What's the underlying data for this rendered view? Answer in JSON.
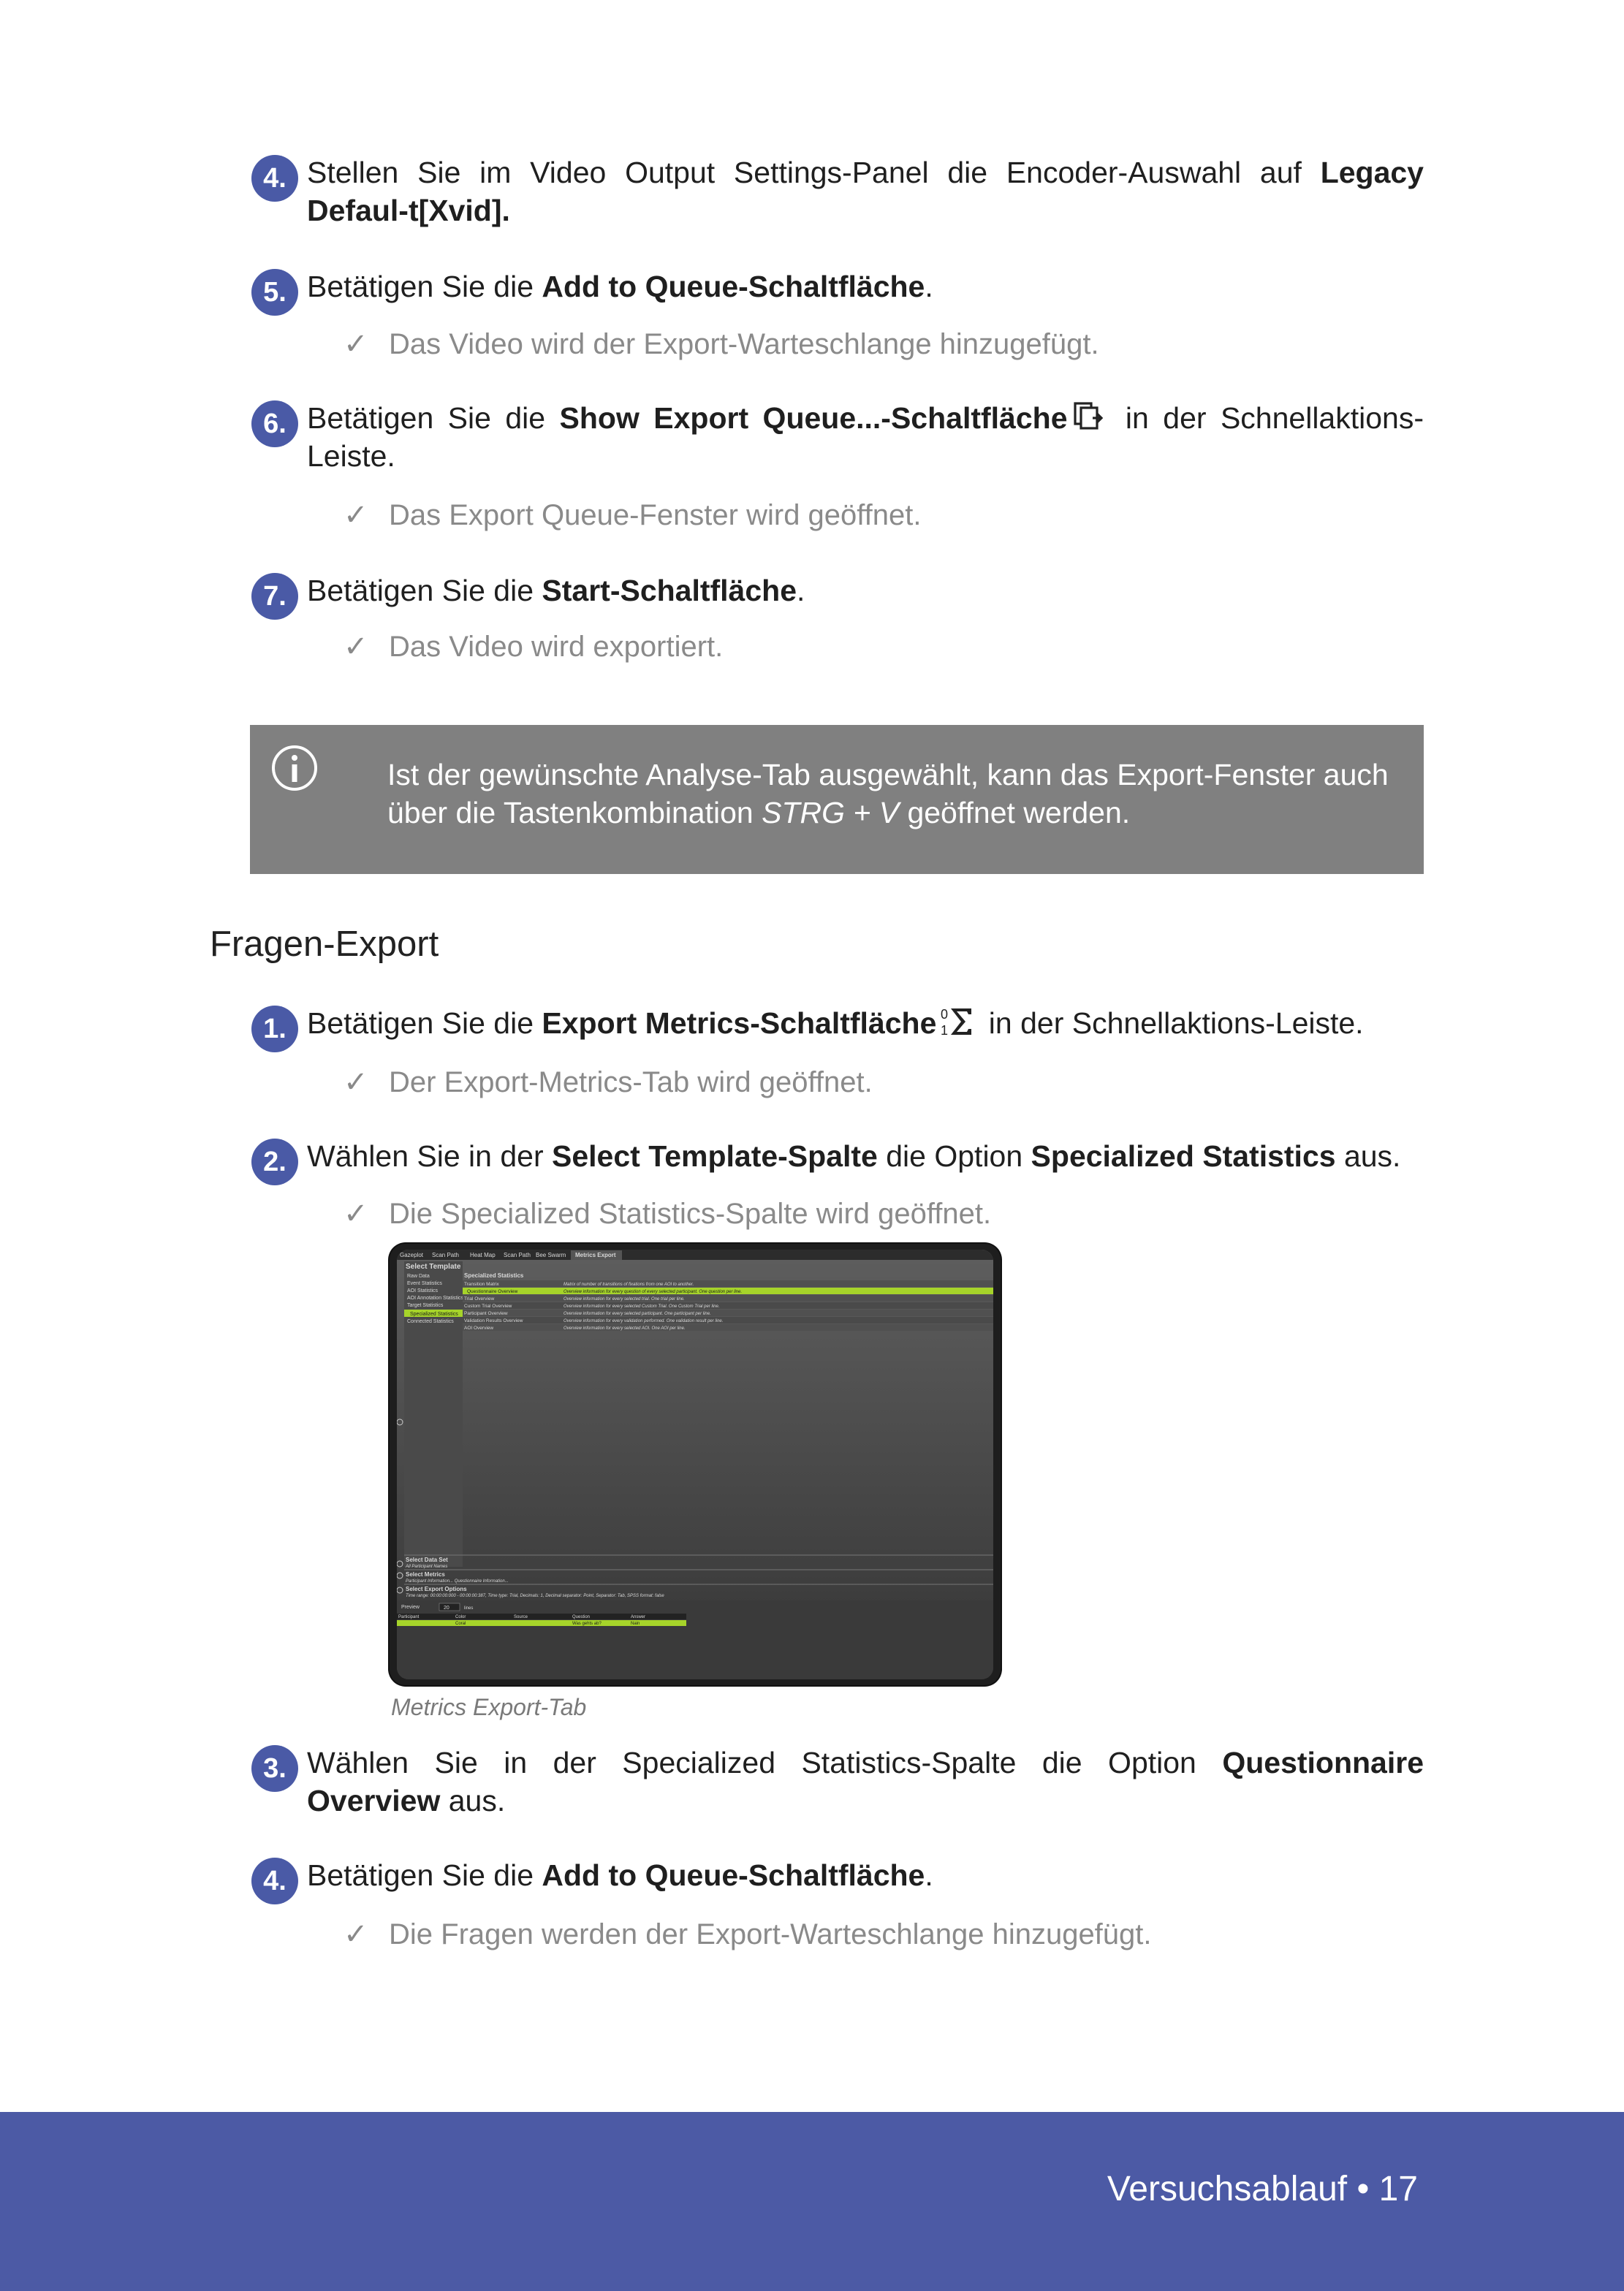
{
  "steps_video": [
    {
      "num": "4.",
      "pre": "Stellen Sie im Video Output Settings-Panel die Encoder-Auswahl auf ",
      "bold": "Legacy Defaul-t[Xvid].",
      "post": ""
    },
    {
      "num": "5.",
      "pre": "Betätigen Sie die ",
      "bold": "Add to Queue-Schaltfläche",
      "post": ".",
      "result": "Das Video wird der Export-Warteschlange hinzugefügt."
    },
    {
      "num": "6.",
      "pre": "Betätigen Sie die ",
      "bold": "Show Export Queue...-Schaltfläche",
      "post": " in der Schnellaktions-Leiste.",
      "result": "Das Export Queue-Fenster wird geöffnet.",
      "icon": "export-queue-icon"
    },
    {
      "num": "7.",
      "pre": "Betätigen Sie die ",
      "bold": "Start-Schaltfläche",
      "post": ".",
      "result": "Das Video wird exportiert."
    }
  ],
  "note": {
    "icon": "info-icon",
    "text_pre": "Ist der gewünschte Analyse-Tab ausgewählt, kann das Export-Fenster auch über die Tastenkombination ",
    "text_italic": "STRG + V",
    "text_post": " geöffnet werden."
  },
  "section_heading": "Fragen-Export",
  "steps_questions": [
    {
      "num": "1.",
      "pre": "Betätigen Sie die ",
      "bold": "Export Metrics-Schaltfläche",
      "post": " in der Schnellaktions-Leiste.",
      "result": "Der Export-Metrics-Tab wird geöffnet.",
      "icon": "export-metrics-icon"
    },
    {
      "num": "2.",
      "pre": "Wählen Sie in der ",
      "bold": "Select Template-Spalte",
      "mid": " die Option ",
      "bold2": "Specialized Statistics",
      "post": " aus.",
      "result": "Die Specialized Statistics-Spalte wird geöffnet."
    },
    {
      "num": "3.",
      "pre": "Wählen Sie in der Specialized Statistics-Spalte die Option ",
      "bold": "Questionnaire Overview",
      "post": " aus."
    },
    {
      "num": "4.",
      "pre": "Betätigen Sie die ",
      "bold": "Add to Queue-Schaltfläche",
      "post": ".",
      "result": "Die Fragen werden der Export-Warteschlange hinzugefügt."
    }
  ],
  "screenshot": {
    "caption": "Metrics Export-Tab",
    "tabs": [
      "Gazeplot",
      "Scan Path",
      "Heat Map",
      "Scan Path",
      "Bee Swarm",
      "Metrics Export"
    ],
    "template_title": "Select Template",
    "templates": [
      "Raw Data",
      "Event Statistics",
      "AOI Statistics",
      "AOI Annotation Statistics",
      "Target Statistics",
      "Specialized Statistics",
      "Connected Statistics"
    ],
    "stats_title": "Specialized Statistics",
    "stats": [
      {
        "name": "Transition Matrix",
        "desc": "Matrix of number of transitions of fixations from one AOI to another."
      },
      {
        "name": "Questionnaire Overview",
        "desc": "Overview information for every question of every selected participant. One question per line."
      },
      {
        "name": "Trial Overview",
        "desc": "Overview information for every selected trial. One trial per line."
      },
      {
        "name": "Custom Trial Overview",
        "desc": "Overview information for every selected Custom Trial. One Custom Trial per line."
      },
      {
        "name": "Participant Overview",
        "desc": "Overview information for every selected participant. One participant per line."
      },
      {
        "name": "Validation Results Overview",
        "desc": "Overview information for every validation performed. One validation result per line."
      },
      {
        "name": "AOI Overview",
        "desc": "Overview information for every selected AOI. One AOI per line."
      }
    ],
    "data_set_title": "Select Data Set",
    "data_set_value": "All Participant Names",
    "metrics_title": "Select Metrics",
    "metrics_value": "Participant Information... Questionnaire Information...",
    "options_title": "Select Export Options",
    "options_value": "Time range: 00:00:00:000 - 00:00:00:387, Time type: Trial, Decimals: 1, Decimal separator: Point, Separator: Tab, SPSS format: false",
    "preview_label": "Preview",
    "preview_lines": "20",
    "preview_lines_label": "lines",
    "preview_columns": [
      "Participant",
      "Color",
      "Source",
      "Question",
      "Answer"
    ],
    "preview_row": [
      "",
      "Coral",
      "",
      "Was gehts ab?",
      "Nain"
    ]
  },
  "footer": "Versuchsablauf • 17",
  "colors": {
    "accent": "#4c5aa5",
    "note_bg": "#808080",
    "highlight": "#a6d42a"
  }
}
